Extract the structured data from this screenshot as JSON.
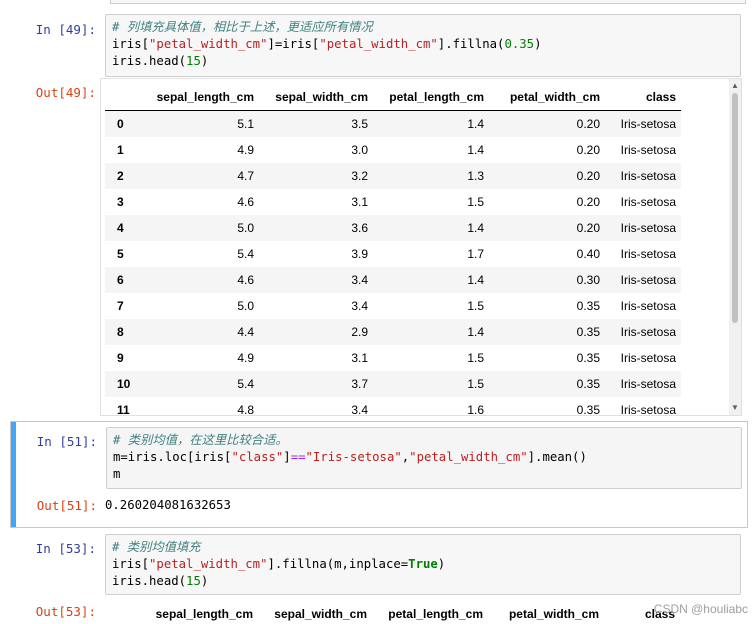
{
  "cell49": {
    "in_prompt": "In  [49]:",
    "code_comment": "# 列填充具体值，相比于上述，更适应所有情况",
    "code_line2_a": "iris[",
    "code_line2_s1": "\"petal_width_cm\"",
    "code_line2_b": "]=iris[",
    "code_line2_s2": "\"petal_width_cm\"",
    "code_line2_c": "].fillna(",
    "code_line2_n": "0.35",
    "code_line2_d": ")",
    "code_line3_a": "iris.head(",
    "code_line3_n": "15",
    "code_line3_b": ")",
    "out_prompt": "Out[49]:"
  },
  "table": {
    "columns": [
      "",
      "sepal_length_cm",
      "sepal_width_cm",
      "petal_length_cm",
      "petal_width_cm",
      "class"
    ],
    "rows": [
      [
        "0",
        "5.1",
        "3.5",
        "1.4",
        "0.20",
        "Iris-setosa"
      ],
      [
        "1",
        "4.9",
        "3.0",
        "1.4",
        "0.20",
        "Iris-setosa"
      ],
      [
        "2",
        "4.7",
        "3.2",
        "1.3",
        "0.20",
        "Iris-setosa"
      ],
      [
        "3",
        "4.6",
        "3.1",
        "1.5",
        "0.20",
        "Iris-setosa"
      ],
      [
        "4",
        "5.0",
        "3.6",
        "1.4",
        "0.20",
        "Iris-setosa"
      ],
      [
        "5",
        "5.4",
        "3.9",
        "1.7",
        "0.40",
        "Iris-setosa"
      ],
      [
        "6",
        "4.6",
        "3.4",
        "1.4",
        "0.30",
        "Iris-setosa"
      ],
      [
        "7",
        "5.0",
        "3.4",
        "1.5",
        "0.35",
        "Iris-setosa"
      ],
      [
        "8",
        "4.4",
        "2.9",
        "1.4",
        "0.35",
        "Iris-setosa"
      ],
      [
        "9",
        "4.9",
        "3.1",
        "1.5",
        "0.35",
        "Iris-setosa"
      ],
      [
        "10",
        "5.4",
        "3.7",
        "1.5",
        "0.35",
        "Iris-setosa"
      ],
      [
        "11",
        "4.8",
        "3.4",
        "1.6",
        "0.35",
        "Iris-setosa"
      ]
    ]
  },
  "cell51": {
    "in_prompt": "In  [51]:",
    "code_comment": "# 类别均值，在这里比较合适。",
    "code_line2_a": "m=iris.loc[iris[",
    "code_line2_s1": "\"class\"",
    "code_line2_b": "]",
    "code_line2_op": "==",
    "code_line2_s2": "\"Iris-setosa\"",
    "code_line2_c": ",",
    "code_line2_s3": "\"petal_width_cm\"",
    "code_line2_d": "].mean()",
    "code_line3": "m",
    "out_prompt": "Out[51]:",
    "out_value": "0.260204081632653"
  },
  "cell53": {
    "in_prompt": "In  [53]:",
    "code_comment": "# 类别均值填充",
    "code_line2_a": "iris[",
    "code_line2_s1": "\"petal_width_cm\"",
    "code_line2_b": "].fillna(m,inplace=",
    "code_line2_kw": "True",
    "code_line2_c": ")",
    "code_line3_a": "iris.head(",
    "code_line3_n": "15",
    "code_line3_b": ")",
    "out_prompt": "Out[53]:"
  },
  "watermark": "CSDN @houliabc",
  "colors": {
    "selected_cell_bar": "#42a5f5",
    "in_prompt": "#303f9f",
    "out_prompt": "#d84315"
  }
}
